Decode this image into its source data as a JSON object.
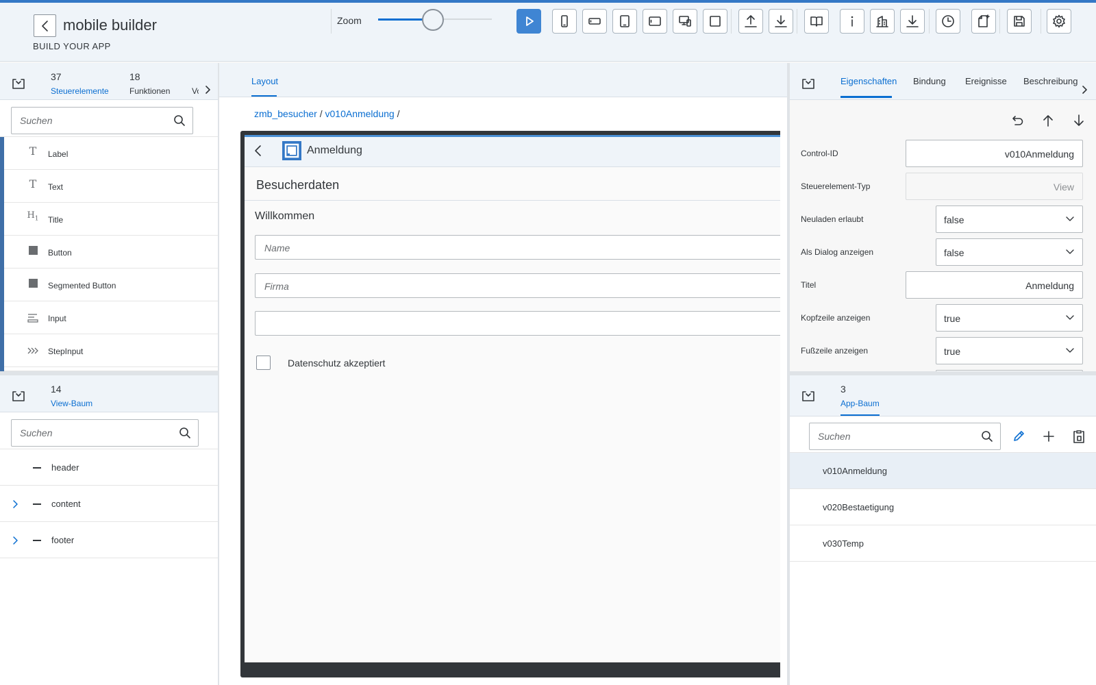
{
  "app": {
    "title": "mobile builder",
    "subtitle": "BUILD YOUR APP",
    "zoom_label": "Zoom",
    "zoom_value": 0.48
  },
  "toolbar": {
    "buttons": [
      {
        "name": "run-preview-button",
        "icon": "play-icon",
        "active": true
      },
      {
        "name": "phone-portrait-button",
        "icon": "phone-portrait-icon"
      },
      {
        "name": "phone-landscape-button",
        "icon": "phone-landscape-icon"
      },
      {
        "name": "tablet-portrait-button",
        "icon": "tablet-portrait-icon"
      },
      {
        "name": "tablet-landscape-button",
        "icon": "tablet-landscape-icon"
      },
      {
        "name": "desktop-button",
        "icon": "desktop-icon"
      },
      {
        "name": "fullscreen-button",
        "icon": "square-icon"
      },
      {
        "name": "upload-button",
        "icon": "upload-icon"
      },
      {
        "name": "download-button",
        "icon": "download-icon"
      },
      {
        "name": "documentation-button",
        "icon": "book-icon"
      },
      {
        "name": "info-button",
        "icon": "info-icon"
      },
      {
        "name": "buildings-button",
        "icon": "buildings-icon"
      },
      {
        "name": "export-button",
        "icon": "download-icon"
      },
      {
        "name": "history-button",
        "icon": "clock-icon"
      },
      {
        "name": "new-document-button",
        "icon": "new-document-icon"
      },
      {
        "name": "save-button",
        "icon": "save-icon"
      },
      {
        "name": "settings-button",
        "icon": "gear-icon"
      }
    ]
  },
  "left_panel": {
    "tabs": [
      {
        "count": "37",
        "label": "Steuerelemente"
      },
      {
        "count": "18",
        "label": "Funktionen"
      },
      {
        "count": "",
        "label": "Vo"
      }
    ],
    "search_placeholder": "Suchen",
    "controls": [
      {
        "icon": "T",
        "label": "Label"
      },
      {
        "icon": "T",
        "label": "Text"
      },
      {
        "icon": "H1",
        "label": "Title"
      },
      {
        "icon": "■",
        "label": "Button"
      },
      {
        "icon": "■",
        "label": "Segmented Button"
      },
      {
        "icon": "input-icon",
        "label": "Input"
      },
      {
        "icon": "step-input-icon",
        "label": "StepInput"
      }
    ],
    "view_tree": {
      "count": "14",
      "label": "View-Baum",
      "search_placeholder": "Suchen",
      "items": [
        {
          "label": "header",
          "expandable": false
        },
        {
          "label": "content",
          "expandable": true
        },
        {
          "label": "footer",
          "expandable": true
        }
      ]
    }
  },
  "center": {
    "tab_label": "Layout",
    "breadcrumb": [
      "zmb_besucher",
      "v010Anmeldung"
    ],
    "breadcrumb_sep": "/",
    "preview": {
      "page_title": "Anmeldung",
      "section_title": "Besucherdaten",
      "welcome": "Willkommen",
      "fields": [
        {
          "placeholder": "Name"
        },
        {
          "placeholder": "Firma"
        },
        {
          "placeholder": ""
        }
      ],
      "checkbox_label": "Datenschutz akzeptiert"
    }
  },
  "right_panel": {
    "tabs": [
      "Eigenschaften",
      "Bindung",
      "Ereignisse",
      "Beschreibung"
    ],
    "active_tab": "Eigenschaften",
    "properties": [
      {
        "label": "Control-ID",
        "type": "input",
        "value": "v010Anmeldung"
      },
      {
        "label": "Steuerelement-Typ",
        "type": "readonly",
        "value": "View"
      },
      {
        "label": "Neuladen erlaubt",
        "type": "select",
        "value": "false"
      },
      {
        "label": "Als Dialog anzeigen",
        "type": "select",
        "value": "false"
      },
      {
        "label": "Titel",
        "type": "input",
        "value": "Anmeldung"
      },
      {
        "label": "Kopfzeile anzeigen",
        "type": "select",
        "value": "true"
      },
      {
        "label": "Fußzeile anzeigen",
        "type": "select",
        "value": "true"
      }
    ],
    "app_tree": {
      "count": "3",
      "label": "App-Baum",
      "search_placeholder": "Suchen",
      "items": [
        {
          "label": "v010Anmeldung",
          "selected": true
        },
        {
          "label": "v020Bestaetigung",
          "selected": false
        },
        {
          "label": "v030Temp",
          "selected": false
        }
      ]
    }
  },
  "colors": {
    "accent": "#0a6ed1",
    "header_bg": "#eff4f9",
    "active_button": "#3f85d3"
  }
}
